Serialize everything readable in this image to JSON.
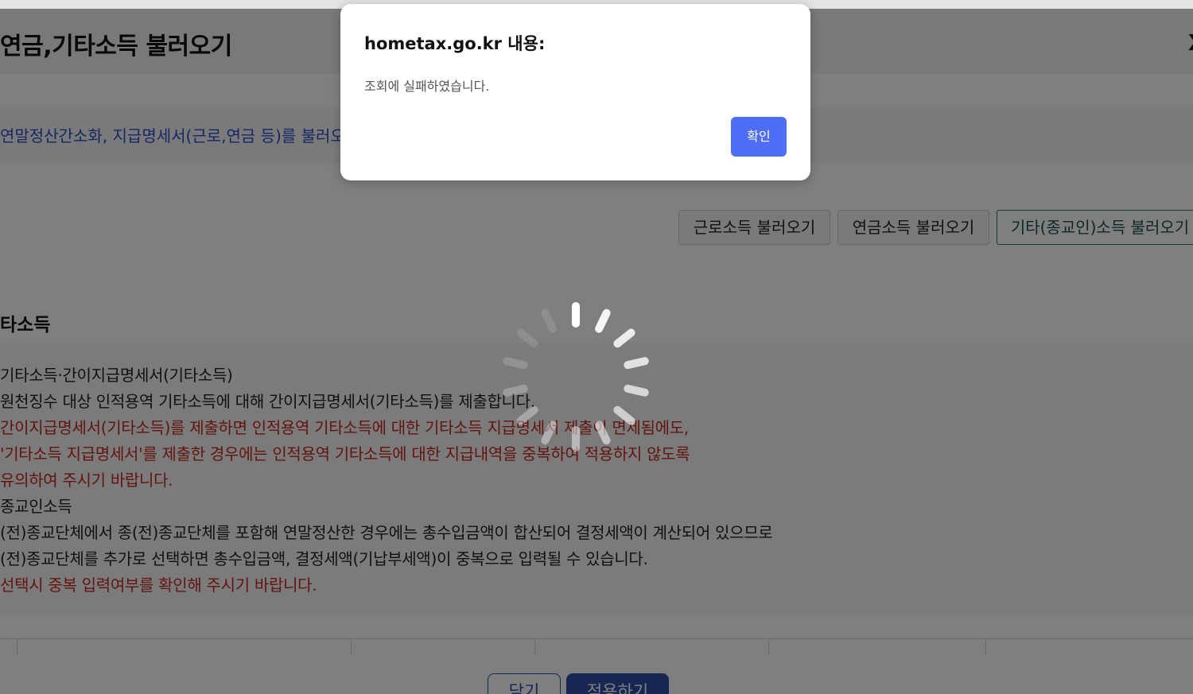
{
  "modal": {
    "title": "연금,기타소득 불러오기",
    "close_symbol": "X",
    "guide_text": "연말정산간소화, 지급명세서(근로,연금 등)를 불러오",
    "buttons": {
      "earned_income": "근로소득 불러오기",
      "pension_income": "연금소득 불러오기",
      "other_income": "기타(종교인)소득 불러오기"
    },
    "section_title": "타소득",
    "notice_lines": [
      "기타소득·간이지급명세서(기타소득)",
      "원천징수 대상 인적용역 기타소득에 대해 간이지급명세서(기타소득)를 제출합니다.",
      "간이지급명세서(기타소득)를 제출하면 인적용역 기타소득에 대한 기타소득 지급명세서 제출이 면제됨에도,",
      "'기타소득 지급명세서'를 제출한 경우에는 인적용역 기타소득에 대한 지급내역을 중복하여 적용하지 않도록",
      "유의하여 주시기 바랍니다.",
      "종교인소득",
      "(전)종교단체에서 종(전)종교단체를 포함해 연말정산한 경우에는 총수입금액이 합산되어 결정세액이 계산되어 있으므로",
      "(전)종교단체를 추가로 선택하면 총수입금액, 결정세액(기납부세액)이 중복으로 입력될 수 있습니다.",
      "선택시 중복 입력여부를 확인해 주시기 바랍니다."
    ],
    "bottom_buttons": {
      "close": "닫기",
      "apply": "적용하기"
    }
  },
  "alert": {
    "title": "hometax.go.kr 내용:",
    "message": "조회에 실패하였습니다.",
    "ok_label": "확인",
    "ok_color": "#4f6ef6"
  },
  "spinner_icon": "loading-spinner-icon"
}
